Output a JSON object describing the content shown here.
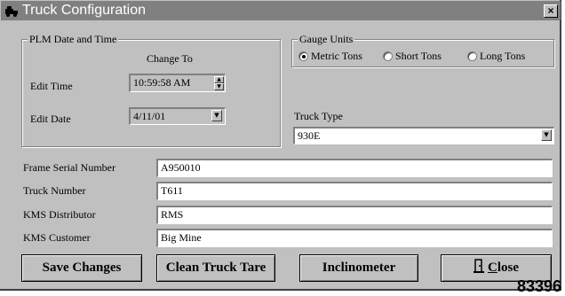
{
  "window": {
    "title": "Truck Configuration",
    "close_glyph": "×"
  },
  "plm": {
    "legend": "PLM Date and Time",
    "change_to": "Change To",
    "edit_time_label": "Edit Time",
    "edit_time_value": "10:59:58 AM",
    "edit_date_label": "Edit Date",
    "edit_date_value": "4/11/01"
  },
  "gauge": {
    "legend": "Gauge Units",
    "options": [
      {
        "label": "Metric Tons",
        "selected": true
      },
      {
        "label": "Short Tons",
        "selected": false
      },
      {
        "label": "Long Tons",
        "selected": false
      }
    ]
  },
  "truck_type": {
    "label": "Truck Type",
    "value": "930E"
  },
  "fields": [
    {
      "label": "Frame Serial Number",
      "value": "A950010"
    },
    {
      "label": "Truck Number",
      "value": "T611"
    },
    {
      "label": "KMS Distributor",
      "value": "RMS"
    },
    {
      "label": "KMS Customer",
      "value": "Big Mine"
    }
  ],
  "buttons": {
    "save": "Save Changes",
    "clean_tare": "Clean Truck Tare",
    "inclinometer": "Inclinometer",
    "close_mnemonic": "C",
    "close_rest": "lose"
  },
  "figure_id": "83396",
  "icons": {
    "title": "truck-app-icon",
    "close": "close-icon",
    "dropdown": "chevron-down-icon",
    "spin_up": "spin-up-icon",
    "spin_down": "spin-down-icon",
    "door": "door-exit-icon"
  }
}
